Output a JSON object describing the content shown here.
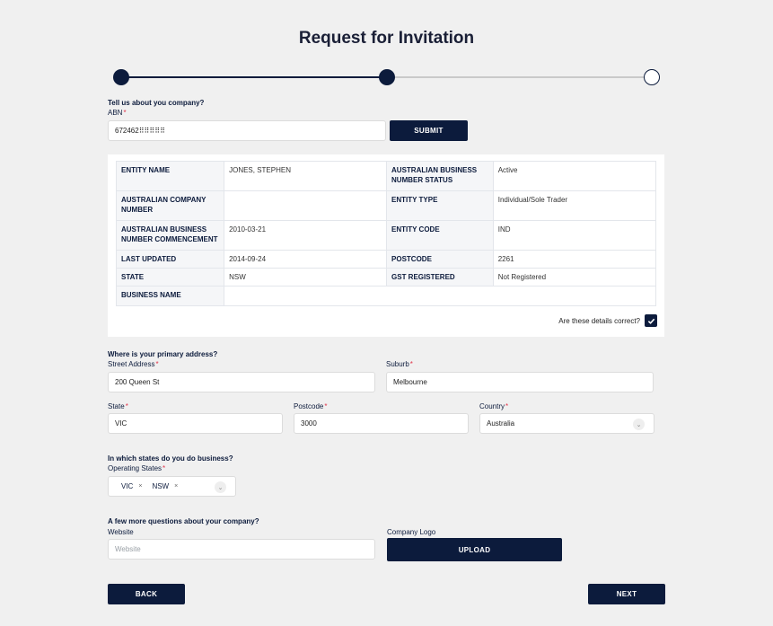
{
  "page": {
    "title": "Request for Invitation"
  },
  "progress": {
    "current_step": 2,
    "total_steps": 3
  },
  "company": {
    "question": "Tell us about you company?",
    "abn_label": "ABN",
    "abn_value": "672462⠿⠿⠿⠿⠿",
    "submit_label": "SUBMIT"
  },
  "details": {
    "entity_name_k": "ENTITY NAME",
    "entity_name_v": "JONES, STEPHEN",
    "abn_status_k": "AUSTRALIAN BUSINESS NUMBER STATUS",
    "abn_status_v": "Active",
    "acn_k": "AUSTRALIAN COMPANY NUMBER",
    "acn_v": "",
    "entity_type_k": "ENTITY TYPE",
    "entity_type_v": "Individual/Sole Trader",
    "abn_comm_k": "AUSTRALIAN BUSINESS NUMBER COMMENCEMENT",
    "abn_comm_v": "2010-03-21",
    "entity_code_k": "ENTITY CODE",
    "entity_code_v": "IND",
    "last_updated_k": "LAST UPDATED",
    "last_updated_v": "2014-09-24",
    "postcode_k": "POSTCODE",
    "postcode_v": "2261",
    "state_k": "STATE",
    "state_v": "NSW",
    "gst_k": "GST REGISTERED",
    "gst_v": "Not Registered",
    "business_name_k": "BUSINESS NAME",
    "business_name_v": "",
    "confirm_label": "Are these details correct?",
    "confirm_checked": true
  },
  "address": {
    "question": "Where is your primary address?",
    "street_label": "Street Address",
    "street_value": "200 Queen St",
    "suburb_label": "Suburb",
    "suburb_value": "Melbourne",
    "state_label": "State",
    "state_value": "VIC",
    "postcode_label": "Postcode",
    "postcode_value": "3000",
    "country_label": "Country",
    "country_value": "Australia"
  },
  "operating": {
    "question": "In which states do you do business?",
    "label": "Operating States",
    "selected": [
      "VIC",
      "NSW"
    ]
  },
  "more": {
    "question": "A few more questions about your company?",
    "website_label": "Website",
    "website_placeholder": "Website",
    "logo_label": "Company Logo",
    "upload_label": "UPLOAD"
  },
  "nav": {
    "back_label": "BACK",
    "next_label": "NEXT"
  },
  "icons": {
    "check": "check-icon",
    "chevron": "chevron-down-icon",
    "remove": "close-icon"
  }
}
